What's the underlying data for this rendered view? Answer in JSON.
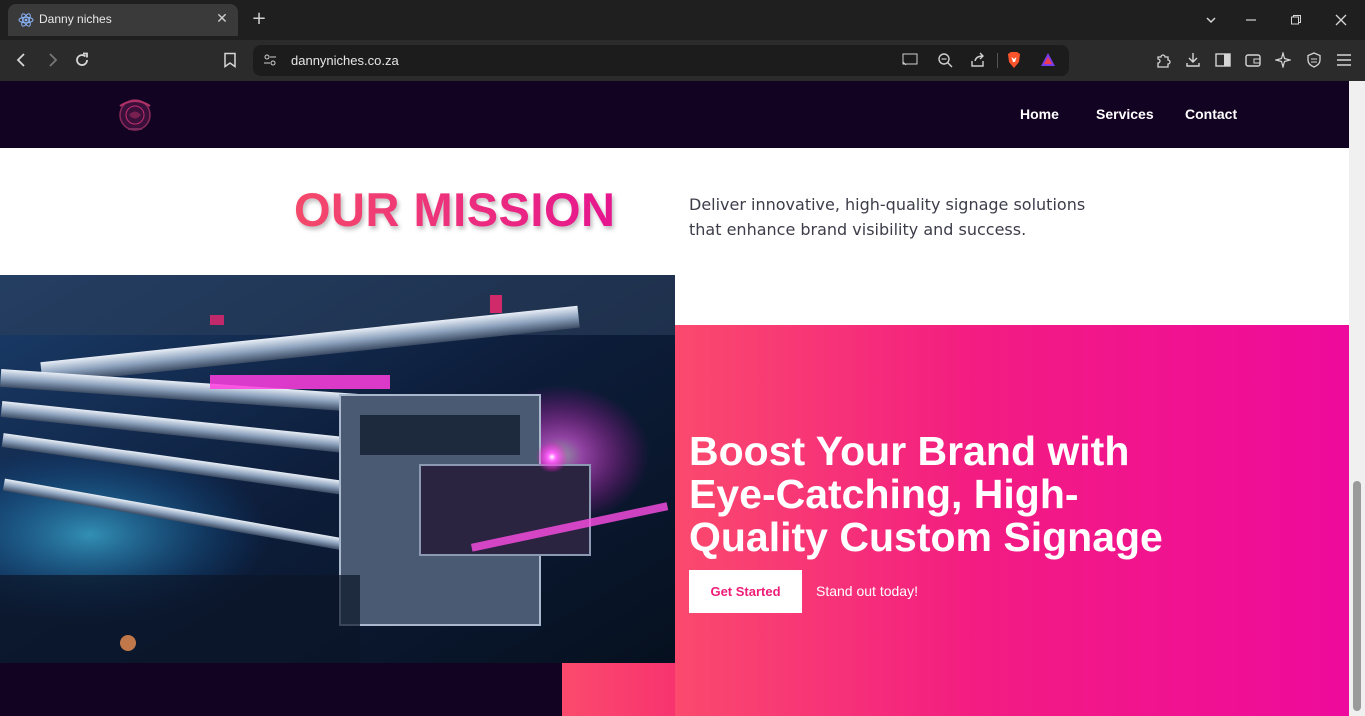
{
  "browser": {
    "tab_title": "Danny niches",
    "url": "dannyniches.co.za"
  },
  "header": {
    "logo_alt": "Danny Niches logo",
    "nav": [
      {
        "label": "Home"
      },
      {
        "label": "Services"
      },
      {
        "label": "Contact"
      }
    ]
  },
  "mission": {
    "title": "OUR MISSION",
    "text": "Deliver innovative, high-quality signage solutions that enhance brand visibility and success."
  },
  "hero": {
    "heading": "Boost Your Brand with Eye-Catching, High-Quality Custom Signage",
    "button_label": "Get Started",
    "subtext": "Stand out today!"
  },
  "colors": {
    "header_bg": "#130322",
    "accent_pink": "#ee0a9c",
    "accent_coral": "#fb4a6d"
  }
}
